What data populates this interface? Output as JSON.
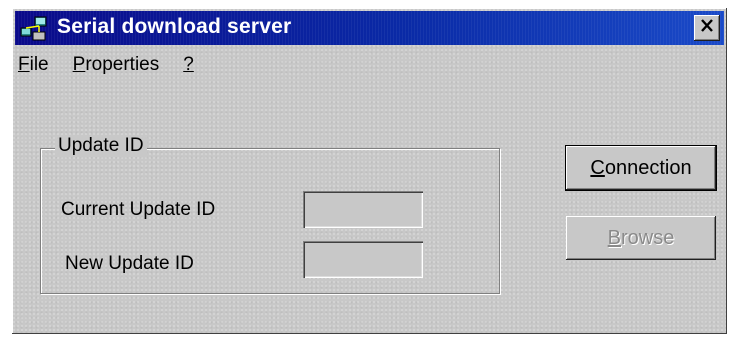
{
  "window": {
    "title": "Serial download server",
    "icon": "network-computers-icon",
    "close_icon": "close-x-icon"
  },
  "menu": [
    {
      "label": "File"
    },
    {
      "label": "Properties"
    },
    {
      "label": "?"
    }
  ],
  "update_group": {
    "label": "Update ID",
    "current_label": "Current Update ID",
    "current_value": "",
    "new_label": "New Update ID",
    "new_value": ""
  },
  "buttons": {
    "connection": "Connection",
    "browse": "Browse"
  },
  "colors": {
    "titlebar": "#0a2aa6",
    "face": "#c8c8c8",
    "disabled_text": "#8a8a8a"
  }
}
